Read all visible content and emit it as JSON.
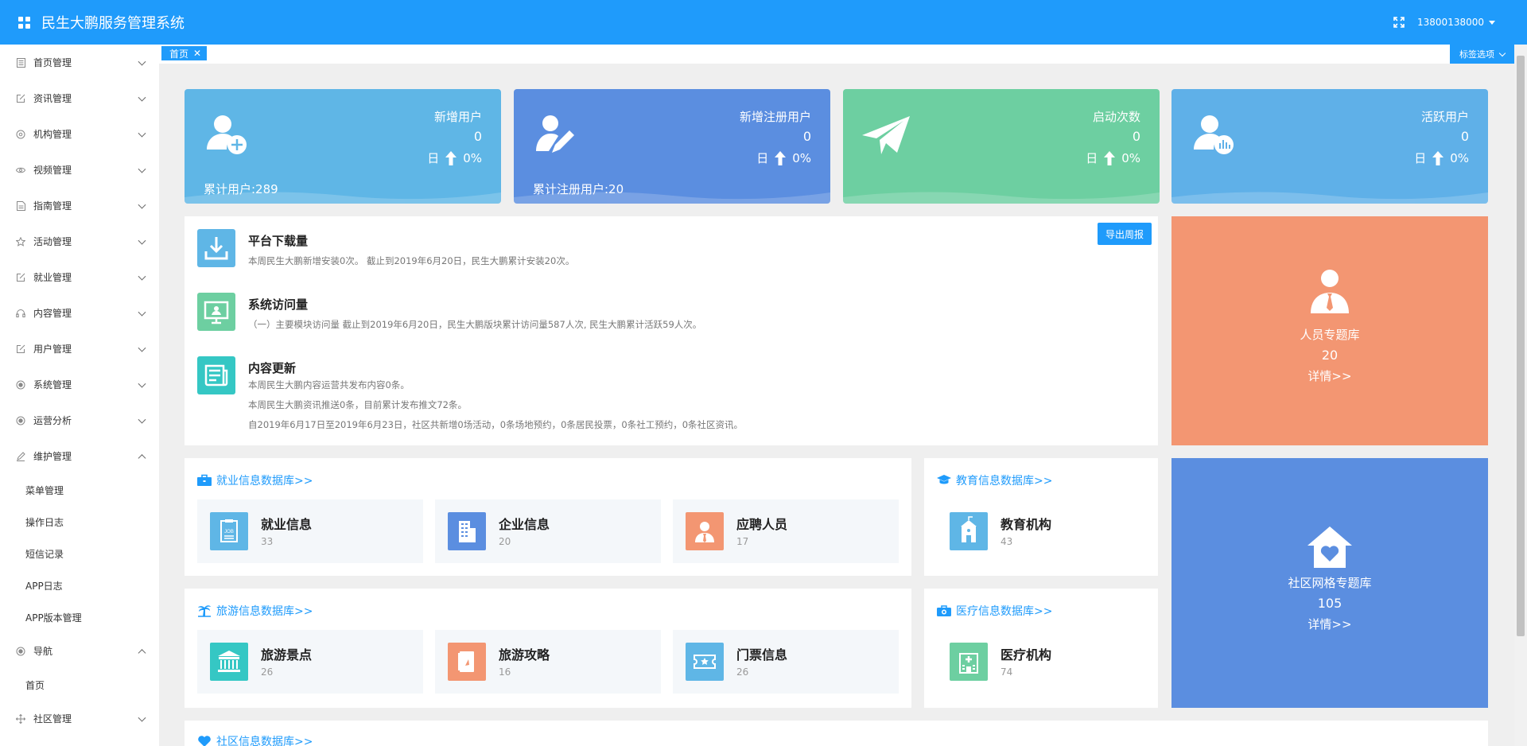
{
  "app": {
    "title": "民生大鹏服务管理系统",
    "user": "13800138000"
  },
  "tabs": {
    "home": "首页",
    "close": "✕",
    "options": "标签选项"
  },
  "sidebar": {
    "items": [
      {
        "label": "首页管理",
        "icon": "document-icon"
      },
      {
        "label": "资讯管理",
        "icon": "edit-icon"
      },
      {
        "label": "机构管理",
        "icon": "location-icon"
      },
      {
        "label": "视频管理",
        "icon": "eye-icon"
      },
      {
        "label": "指南管理",
        "icon": "document-icon"
      },
      {
        "label": "活动管理",
        "icon": "star-icon"
      },
      {
        "label": "就业管理",
        "icon": "edit-icon"
      },
      {
        "label": "内容管理",
        "icon": "headset-icon"
      },
      {
        "label": "用户管理",
        "icon": "edit-icon"
      },
      {
        "label": "系统管理",
        "icon": "target-icon"
      },
      {
        "label": "运营分析",
        "icon": "target-icon"
      },
      {
        "label": "维护管理",
        "icon": "pen-icon"
      }
    ],
    "maintenance_sub": [
      "菜单管理",
      "操作日志",
      "短信记录",
      "APP日志",
      "APP版本管理"
    ],
    "nav": {
      "label": "导航",
      "icon": "target-icon"
    },
    "nav_sub": [
      "首页"
    ],
    "community": {
      "label": "社区管理",
      "icon": "move-icon"
    }
  },
  "stats": [
    {
      "label": "新增用户",
      "value": "0",
      "period": "日",
      "rate": "0%",
      "total": "累计用户:289",
      "color": "#5fb6e6"
    },
    {
      "label": "新增注册用户",
      "value": "0",
      "period": "日",
      "rate": "0%",
      "total": "累计注册用户:20",
      "color": "#5b8ee0"
    },
    {
      "label": "启动次数",
      "value": "0",
      "period": "日",
      "rate": "0%",
      "total": "",
      "color": "#6dcfa1"
    },
    {
      "label": "活跃用户",
      "value": "0",
      "period": "日",
      "rate": "0%",
      "total": "",
      "color": "#5fb0e8"
    }
  ],
  "overview": {
    "export": "导出周报",
    "download": {
      "title": "平台下载量",
      "desc": "本周民生大鹏新增安装0次。 截止到2019年6月20日，民生大鹏累计安装20次。"
    },
    "visits": {
      "title": "系统访问量",
      "desc": "（一）主要模块访问量 截止到2019年6月20日，民生大鹏版块累计访问量587人次, 民生大鹏累计活跃59人次。"
    },
    "content": {
      "title": "内容更新",
      "lines": [
        "本周民生大鹏内容运营共发布内容0条。",
        "本周民生大鹏资讯推送0条，目前累计发布推文72条。",
        "自2019年6月17日至2019年6月23日，社区共新增0场活动，0条场地预约，0条居民投票，0条社工预约，0条社区资讯。"
      ]
    }
  },
  "features": {
    "people": {
      "name": "人员专题库",
      "value": "20",
      "link": "详情>>",
      "color": "#f39672"
    },
    "community": {
      "name": "社区网格专题库",
      "value": "105",
      "link": "详情>>",
      "color": "#5b8ee0"
    }
  },
  "databases": {
    "employment": {
      "title": "就业信息数据库>>",
      "cards": [
        {
          "name": "就业信息",
          "count": "33",
          "color": "#5fb6e6"
        },
        {
          "name": "企业信息",
          "count": "20",
          "color": "#5b8ee0"
        },
        {
          "name": "应聘人员",
          "count": "17",
          "color": "#f39672"
        }
      ]
    },
    "education": {
      "title": "教育信息数据库>>",
      "cards": [
        {
          "name": "教育机构",
          "count": "43",
          "color": "#5fb6e6"
        }
      ]
    },
    "tourism": {
      "title": "旅游信息数据库>>",
      "cards": [
        {
          "name": "旅游景点",
          "count": "26",
          "color": "#35c7c4"
        },
        {
          "name": "旅游攻略",
          "count": "16",
          "color": "#f39672"
        },
        {
          "name": "门票信息",
          "count": "26",
          "color": "#5fb6e6"
        }
      ]
    },
    "medical": {
      "title": "医疗信息数据库>>",
      "cards": [
        {
          "name": "医疗机构",
          "count": "74",
          "color": "#6dcfa1"
        }
      ]
    },
    "community": {
      "title": "社区信息数据库>>"
    }
  }
}
